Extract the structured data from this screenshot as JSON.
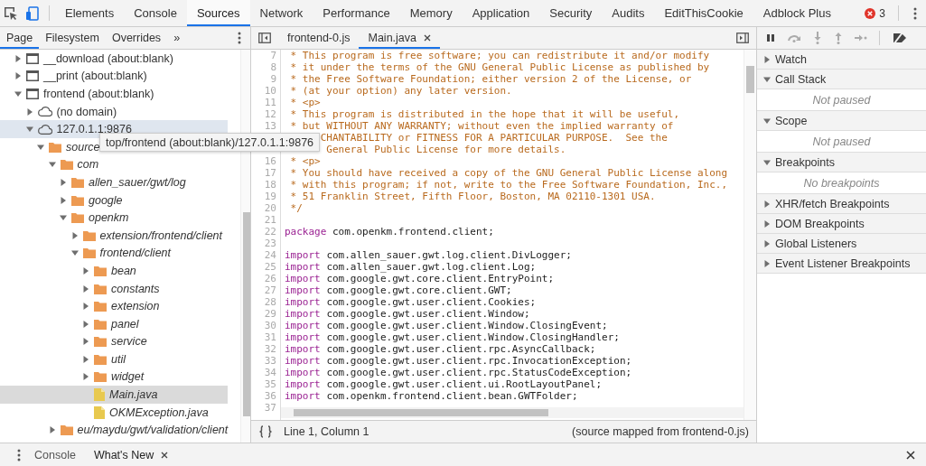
{
  "main_tabs": [
    {
      "label": "Elements",
      "selected": false
    },
    {
      "label": "Console",
      "selected": false
    },
    {
      "label": "Sources",
      "selected": true
    },
    {
      "label": "Network",
      "selected": false
    },
    {
      "label": "Performance",
      "selected": false
    },
    {
      "label": "Memory",
      "selected": false
    },
    {
      "label": "Application",
      "selected": false
    },
    {
      "label": "Security",
      "selected": false
    },
    {
      "label": "Audits",
      "selected": false
    },
    {
      "label": "EditThisCookie",
      "selected": false
    },
    {
      "label": "Adblock Plus",
      "selected": false
    }
  ],
  "error_count": "3",
  "navigator": {
    "tabs": [
      {
        "label": "Page",
        "selected": true
      },
      {
        "label": "Filesystem",
        "selected": false
      },
      {
        "label": "Overrides",
        "selected": false
      }
    ],
    "more": "»",
    "tree": [
      {
        "label": "__download (about:blank)",
        "kind": "frame",
        "expanded": false,
        "selected": false,
        "hovered": false
      },
      {
        "label": "__print (about:blank)",
        "kind": "frame",
        "expanded": false,
        "selected": false,
        "hovered": false
      },
      {
        "label": "frontend (about:blank)",
        "kind": "frame",
        "expanded": true,
        "selected": false,
        "hovered": false,
        "children": [
          {
            "label": "(no domain)",
            "kind": "domain",
            "expanded": false,
            "selected": false,
            "hovered": false
          },
          {
            "label": "127.0.1.1:9876",
            "kind": "domain",
            "expanded": true,
            "selected": false,
            "hovered": true,
            "children": [
              {
                "label": "source",
                "kind": "folder",
                "expanded": true,
                "selected": false,
                "hovered": false,
                "children": [
                  {
                    "label": "com",
                    "kind": "folder",
                    "expanded": true,
                    "selected": false,
                    "hovered": false,
                    "children": [
                      {
                        "label": "allen_sauer/gwt/log",
                        "kind": "folder",
                        "expanded": false,
                        "selected": false,
                        "hovered": false
                      },
                      {
                        "label": "google",
                        "kind": "folder",
                        "expanded": false,
                        "selected": false,
                        "hovered": false
                      },
                      {
                        "label": "openkm",
                        "kind": "folder",
                        "expanded": true,
                        "selected": false,
                        "hovered": false,
                        "children": [
                          {
                            "label": "extension/frontend/client",
                            "kind": "folder",
                            "expanded": false,
                            "selected": false,
                            "hovered": false
                          },
                          {
                            "label": "frontend/client",
                            "kind": "folder",
                            "expanded": true,
                            "selected": false,
                            "hovered": false,
                            "children": [
                              {
                                "label": "bean",
                                "kind": "folder",
                                "expanded": false,
                                "selected": false,
                                "hovered": false
                              },
                              {
                                "label": "constants",
                                "kind": "folder",
                                "expanded": false,
                                "selected": false,
                                "hovered": false
                              },
                              {
                                "label": "extension",
                                "kind": "folder",
                                "expanded": false,
                                "selected": false,
                                "hovered": false
                              },
                              {
                                "label": "panel",
                                "kind": "folder",
                                "expanded": false,
                                "selected": false,
                                "hovered": false
                              },
                              {
                                "label": "service",
                                "kind": "folder",
                                "expanded": false,
                                "selected": false,
                                "hovered": false
                              },
                              {
                                "label": "util",
                                "kind": "folder",
                                "expanded": false,
                                "selected": false,
                                "hovered": false
                              },
                              {
                                "label": "widget",
                                "kind": "folder",
                                "expanded": false,
                                "selected": false,
                                "hovered": false
                              },
                              {
                                "label": "Main.java",
                                "kind": "file",
                                "selected": true,
                                "hovered": false
                              },
                              {
                                "label": "OKMException.java",
                                "kind": "file",
                                "selected": false,
                                "hovered": false
                              }
                            ]
                          }
                        ]
                      }
                    ]
                  },
                  {
                    "label": "eu/maydu/gwt/validation/client",
                    "kind": "folder",
                    "expanded": false,
                    "selected": false,
                    "hovered": false
                  }
                ]
              }
            ]
          }
        ]
      }
    ],
    "tooltip": "top/frontend (about:blank)/127.0.1.1:9876"
  },
  "editor": {
    "tabs": [
      {
        "label": "frontend-0.js",
        "selected": false,
        "closable": false
      },
      {
        "label": "Main.java",
        "selected": true,
        "closable": true
      }
    ],
    "lines": [
      {
        "number": "7",
        "kind": "comment",
        "text": " * This program is free software; you can redistribute it and/or modify"
      },
      {
        "number": "8",
        "kind": "comment",
        "text": " * it under the terms of the GNU General Public License as published by"
      },
      {
        "number": "9",
        "kind": "comment",
        "text": " * the Free Software Foundation; either version 2 of the License, or"
      },
      {
        "number": "10",
        "kind": "comment",
        "text": " * (at your option) any later version."
      },
      {
        "number": "11",
        "kind": "comment",
        "text": " * <p>"
      },
      {
        "number": "12",
        "kind": "comment",
        "text": " * This program is distributed in the hope that it will be useful,"
      },
      {
        "number": "13",
        "kind": "comment",
        "text": " * but WITHOUT ANY WARRANTY; without even the implied warranty of"
      },
      {
        "kind": "comment",
        "text": "      CHANTABILITY or FITNESS FOR A PARTICULAR PURPOSE.  See the"
      },
      {
        "kind": "comment",
        "text": "       General Public License for more details."
      },
      {
        "number": "16",
        "kind": "comment",
        "text": " * <p>"
      },
      {
        "number": "17",
        "kind": "comment",
        "text": " * You should have received a copy of the GNU General Public License along"
      },
      {
        "number": "18",
        "kind": "comment",
        "text": " * with this program; if not, write to the Free Software Foundation, Inc.,"
      },
      {
        "number": "19",
        "kind": "comment",
        "text": " * 51 Franklin Street, Fifth Floor, Boston, MA 02110-1301 USA."
      },
      {
        "number": "20",
        "kind": "comment",
        "text": " */"
      },
      {
        "number": "21",
        "kind": "blank"
      },
      {
        "number": "22",
        "kind": "code",
        "keyword": "package",
        "text": "com.openkm.frontend.client;"
      },
      {
        "number": "23",
        "kind": "blank"
      },
      {
        "number": "24",
        "kind": "code",
        "keyword": "import",
        "text": "com.allen_sauer.gwt.log.client.DivLogger;"
      },
      {
        "number": "25",
        "kind": "code",
        "keyword": "import",
        "text": "com.allen_sauer.gwt.log.client.Log;"
      },
      {
        "number": "26",
        "kind": "code",
        "keyword": "import",
        "text": "com.google.gwt.core.client.EntryPoint;"
      },
      {
        "number": "27",
        "kind": "code",
        "keyword": "import",
        "text": "com.google.gwt.core.client.GWT;"
      },
      {
        "number": "28",
        "kind": "code",
        "keyword": "import",
        "text": "com.google.gwt.user.client.Cookies;"
      },
      {
        "number": "29",
        "kind": "code",
        "keyword": "import",
        "text": "com.google.gwt.user.client.Window;"
      },
      {
        "number": "30",
        "kind": "code",
        "keyword": "import",
        "text": "com.google.gwt.user.client.Window.ClosingEvent;"
      },
      {
        "number": "31",
        "kind": "code",
        "keyword": "import",
        "text": "com.google.gwt.user.client.Window.ClosingHandler;"
      },
      {
        "number": "32",
        "kind": "code",
        "keyword": "import",
        "text": "com.google.gwt.user.client.rpc.AsyncCallback;"
      },
      {
        "number": "33",
        "kind": "code",
        "keyword": "import",
        "text": "com.google.gwt.user.client.rpc.InvocationException;"
      },
      {
        "number": "34",
        "kind": "code",
        "keyword": "import",
        "text": "com.google.gwt.user.client.rpc.StatusCodeException;"
      },
      {
        "number": "35",
        "kind": "code",
        "keyword": "import",
        "text": "com.google.gwt.user.client.ui.RootLayoutPanel;"
      },
      {
        "number": "36",
        "kind": "code",
        "keyword": "import",
        "text": "com.openkm.frontend.client.bean.GWTFolder;"
      },
      {
        "number": "37",
        "kind": "blank"
      }
    ],
    "status": {
      "position": "Line 1, Column 1",
      "source_map": "(source mapped from frontend-0.js)"
    }
  },
  "debugger": {
    "sections": [
      {
        "title": "Watch",
        "expanded": false
      },
      {
        "title": "Call Stack",
        "expanded": true,
        "message": "Not paused"
      },
      {
        "title": "Scope",
        "expanded": true,
        "message": "Not paused"
      },
      {
        "title": "Breakpoints",
        "expanded": true,
        "message": "No breakpoints"
      },
      {
        "title": "XHR/fetch Breakpoints",
        "expanded": false
      },
      {
        "title": "DOM Breakpoints",
        "expanded": false
      },
      {
        "title": "Global Listeners",
        "expanded": false
      },
      {
        "title": "Event Listener Breakpoints",
        "expanded": false
      }
    ]
  },
  "drawer": {
    "tabs": [
      {
        "label": "Console",
        "selected": false,
        "closable": false
      },
      {
        "label": "What's New",
        "selected": true,
        "closable": true
      }
    ]
  }
}
